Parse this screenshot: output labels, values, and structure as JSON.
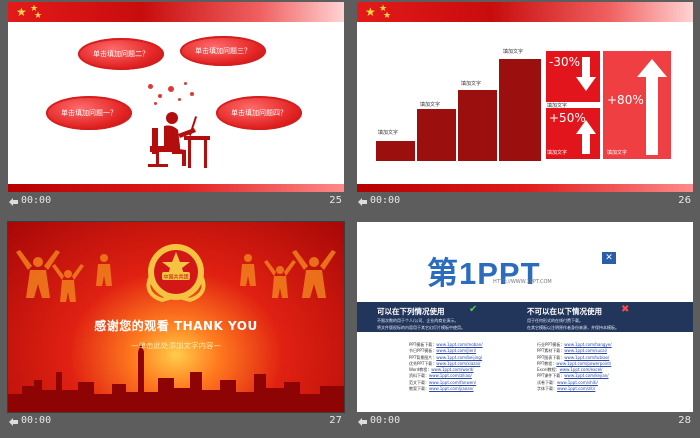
{
  "slides": [
    {
      "number": "25",
      "duration": "00:00",
      "clouds": [
        "单击填加问题二？",
        "单击填加问题三？",
        "单击填加问题一？",
        "单击填加问题四？"
      ]
    },
    {
      "number": "26",
      "duration": "00:00",
      "bar_label": "填加文字",
      "bar_labels": [
        "填加文字",
        "填加文字",
        "填加文字",
        "填加文字"
      ],
      "percents": [
        "-30%",
        "+50%",
        "+80%"
      ],
      "percent_labels": [
        "填加文字",
        "填加文字",
        "填加文字"
      ]
    },
    {
      "number": "27",
      "duration": "00:00",
      "title": "感谢您的观看    THANK YOU",
      "subtitle": "—单击此处添加文字内容—"
    },
    {
      "number": "28",
      "duration": "00:00",
      "logo_text": "第1PPT",
      "logo_url": "HTTP://WWW.1PPT.COM",
      "can_use_heading": "可以在下列情况使用",
      "cannot_use_heading": "不可以在以下情况使用",
      "can_use_lines": [
        "不限次数的用于个人/公司、企业的商业演示。",
        "将文件版权标的内容用于其它幻灯片模板中使用。"
      ],
      "cannot_use_lines": [
        "用于任何形式的在线付费下载。",
        "在其它模板以注明原作者身份来源，并保持本模板。"
      ],
      "left_links": [
        {
          "label": "PPT模板下载：",
          "url": "www.1ppt.com/moban/"
        },
        {
          "label": "节日PPT模板：",
          "url": "www.1ppt.com/jieri/"
        },
        {
          "label": "PPT背景图片：",
          "url": "www.1ppt.com/beijing/"
        },
        {
          "label": "优秀PPT下载：",
          "url": "www.1ppt.com/xiazai/"
        },
        {
          "label": "Word教程：",
          "url": "www.1ppt.com/word/"
        },
        {
          "label": "资料下载：",
          "url": "www.1ppt.com/ziliao/"
        },
        {
          "label": "范文下载：",
          "url": "www.1ppt.com/fanwen/"
        },
        {
          "label": "教案下载：",
          "url": "www.1ppt.com/jiaoan/"
        }
      ],
      "right_links": [
        {
          "label": "行业PPT模板：",
          "url": "www.1ppt.com/hangye/"
        },
        {
          "label": "PPT素材下载：",
          "url": "www.1ppt.com/sucai/"
        },
        {
          "label": "PPT图表下载：",
          "url": "www.1ppt.com/tubiao/"
        },
        {
          "label": "PPT教程：",
          "url": "www.1ppt.com/powerpoint/"
        },
        {
          "label": "Excel教程：",
          "url": "www.1ppt.com/excel/"
        },
        {
          "label": "PPT课件下载：",
          "url": "www.1ppt.com/kejian/"
        },
        {
          "label": "试卷下载：",
          "url": "www.1ppt.com/shiti/"
        },
        {
          "label": "字体下载：",
          "url": "www.1ppt.com/ziti/"
        }
      ]
    }
  ],
  "colors": {
    "background": "#5d5d5d",
    "accent_red": "#e31a1a",
    "dark_red": "#9b0f0f",
    "logo_blue": "#2b6cbf",
    "band_navy": "#22365c"
  }
}
